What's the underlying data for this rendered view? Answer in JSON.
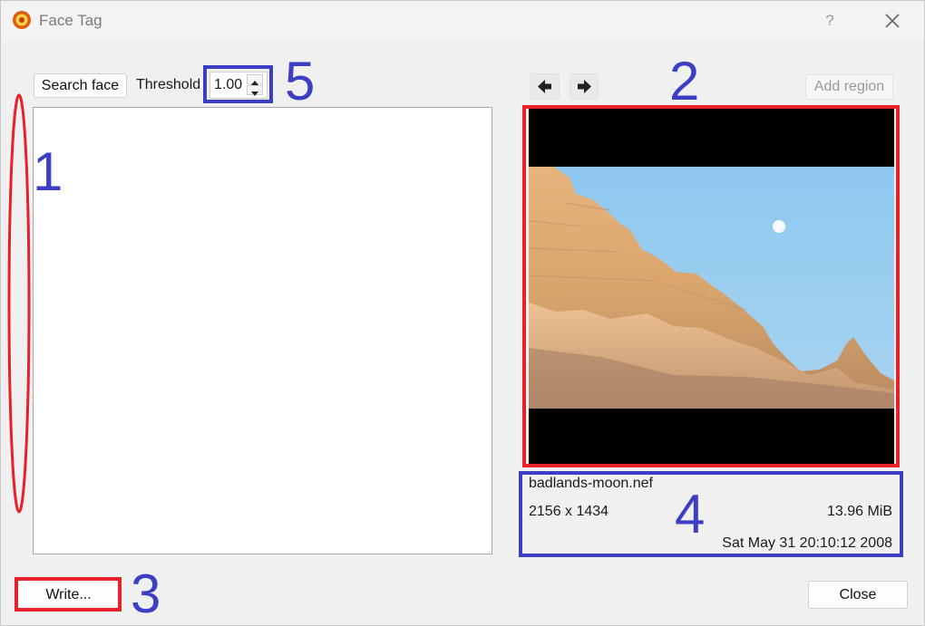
{
  "window": {
    "title": "Face Tag",
    "help_label": "?"
  },
  "toolbar": {
    "search_face_label": "Search face",
    "threshold_label": "Threshold",
    "threshold_value": "1.00"
  },
  "image_panel": {
    "add_region_label": "Add region",
    "prev_icon": "arrow-left-icon",
    "next_icon": "arrow-right-icon"
  },
  "file_info": {
    "name": "badlands-moon.nef",
    "dimensions": "2156 x 1434",
    "size": "13.96 MiB",
    "date": "Sat May 31 20:10:12 2008"
  },
  "footer": {
    "write_label": "Write...",
    "close_label": "Close"
  },
  "annotations": [
    "1",
    "2",
    "3",
    "4",
    "5"
  ],
  "colors": {
    "annotation_red": "#e8202a",
    "annotation_blue": "#3c3fc4"
  }
}
